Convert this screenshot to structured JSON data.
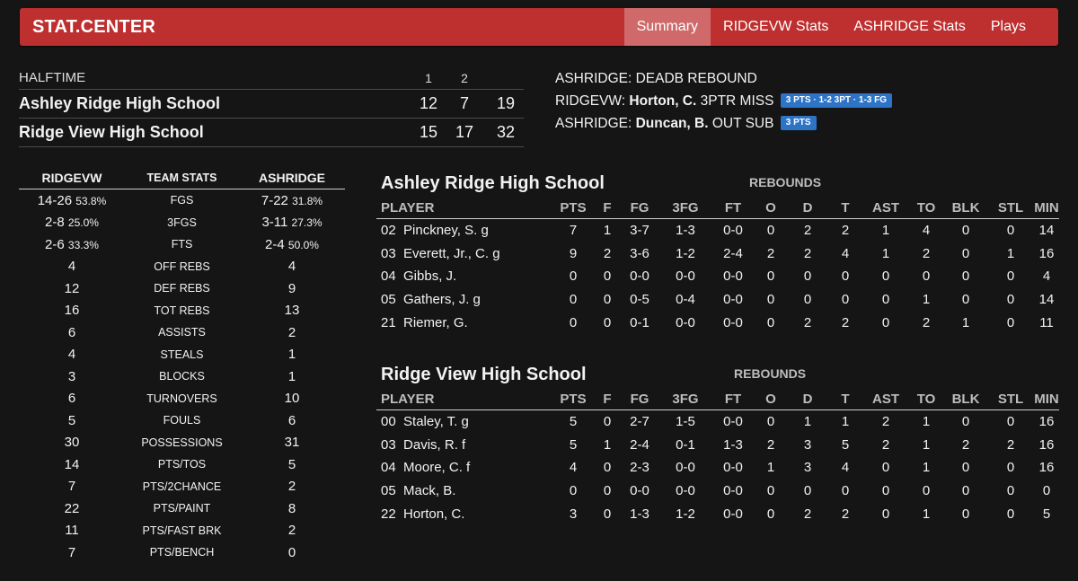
{
  "header": {
    "brand": "STAT.CENTER",
    "nav": [
      "Summary",
      "RIDGEVW Stats",
      "ASHRIDGE Stats",
      "Plays"
    ],
    "active_index": 0
  },
  "scoreboard": {
    "period_label": "HALFTIME",
    "periods": [
      "1",
      "2"
    ],
    "teams": [
      {
        "name": "Ashley Ridge High School",
        "p1": "12",
        "p2": "7",
        "total": "19"
      },
      {
        "name": "Ridge View High School",
        "p1": "15",
        "p2": "17",
        "total": "32"
      }
    ]
  },
  "plays": [
    {
      "team": "ASHRIDGE:",
      "player": "",
      "action": "DEADB REBOUND",
      "badge": ""
    },
    {
      "team": "RIDGEVW:",
      "player": "Horton, C.",
      "action": "3PTR MISS",
      "badge": "3 PTS · 1-2 3PT · 1-3 FG"
    },
    {
      "team": "ASHRIDGE:",
      "player": "Duncan, B.",
      "action": "OUT SUB",
      "badge": "3 PTS"
    }
  ],
  "team_stats": {
    "headers": [
      "RIDGEVW",
      "TEAM STATS",
      "ASHRIDGE"
    ],
    "rows": [
      {
        "l": "14-26",
        "lp": "53.8%",
        "label": "FGS",
        "r": "7-22",
        "rp": "31.8%"
      },
      {
        "l": "2-8",
        "lp": "25.0%",
        "label": "3FGS",
        "r": "3-11",
        "rp": "27.3%"
      },
      {
        "l": "2-6",
        "lp": "33.3%",
        "label": "FTS",
        "r": "2-4",
        "rp": "50.0%"
      },
      {
        "l": "4",
        "lp": "",
        "label": "OFF REBS",
        "r": "4",
        "rp": ""
      },
      {
        "l": "12",
        "lp": "",
        "label": "DEF REBS",
        "r": "9",
        "rp": ""
      },
      {
        "l": "16",
        "lp": "",
        "label": "TOT REBS",
        "r": "13",
        "rp": ""
      },
      {
        "l": "6",
        "lp": "",
        "label": "ASSISTS",
        "r": "2",
        "rp": ""
      },
      {
        "l": "4",
        "lp": "",
        "label": "STEALS",
        "r": "1",
        "rp": ""
      },
      {
        "l": "3",
        "lp": "",
        "label": "BLOCKS",
        "r": "1",
        "rp": ""
      },
      {
        "l": "6",
        "lp": "",
        "label": "TURNOVERS",
        "r": "10",
        "rp": ""
      },
      {
        "l": "5",
        "lp": "",
        "label": "FOULS",
        "r": "6",
        "rp": ""
      },
      {
        "l": "30",
        "lp": "",
        "label": "POSSESSIONS",
        "r": "31",
        "rp": ""
      },
      {
        "l": "14",
        "lp": "",
        "label": "PTS/TOS",
        "r": "5",
        "rp": ""
      },
      {
        "l": "7",
        "lp": "",
        "label": "PTS/2CHANCE",
        "r": "2",
        "rp": ""
      },
      {
        "l": "22",
        "lp": "",
        "label": "PTS/PAINT",
        "r": "8",
        "rp": ""
      },
      {
        "l": "11",
        "lp": "",
        "label": "PTS/FAST BRK",
        "r": "2",
        "rp": ""
      },
      {
        "l": "7",
        "lp": "",
        "label": "PTS/BENCH",
        "r": "0",
        "rp": ""
      }
    ]
  },
  "box_scores": [
    {
      "title": "Ashley Ridge High School",
      "rebounds_label": "REBOUNDS",
      "columns": [
        "PLAYER",
        "PTS",
        "F",
        "FG",
        "3FG",
        "FT",
        "O",
        "D",
        "T",
        "AST",
        "TO",
        "BLK",
        "STL",
        "MIN"
      ],
      "rows": [
        [
          "02  Pinckney, S. g",
          "7",
          "1",
          "3-7",
          "1-3",
          "0-0",
          "0",
          "2",
          "2",
          "1",
          "4",
          "0",
          "0",
          "14"
        ],
        [
          "03  Everett, Jr., C. g",
          "9",
          "2",
          "3-6",
          "1-2",
          "2-4",
          "2",
          "2",
          "4",
          "1",
          "2",
          "0",
          "1",
          "16"
        ],
        [
          "04  Gibbs, J.",
          "0",
          "0",
          "0-0",
          "0-0",
          "0-0",
          "0",
          "0",
          "0",
          "0",
          "0",
          "0",
          "0",
          "4"
        ],
        [
          "05  Gathers, J. g",
          "0",
          "0",
          "0-5",
          "0-4",
          "0-0",
          "0",
          "0",
          "0",
          "0",
          "1",
          "0",
          "0",
          "14"
        ],
        [
          "21  Riemer, G.",
          "0",
          "0",
          "0-1",
          "0-0",
          "0-0",
          "0",
          "2",
          "2",
          "0",
          "2",
          "1",
          "0",
          "11"
        ]
      ]
    },
    {
      "title": "Ridge View High School",
      "rebounds_label": "REBOUNDS",
      "columns": [
        "PLAYER",
        "PTS",
        "F",
        "FG",
        "3FG",
        "FT",
        "O",
        "D",
        "T",
        "AST",
        "TO",
        "BLK",
        "STL",
        "MIN"
      ],
      "rows": [
        [
          "00  Staley, T. g",
          "5",
          "0",
          "2-7",
          "1-5",
          "0-0",
          "0",
          "1",
          "1",
          "2",
          "1",
          "0",
          "0",
          "16"
        ],
        [
          "03  Davis, R. f",
          "5",
          "1",
          "2-4",
          "0-1",
          "1-3",
          "2",
          "3",
          "5",
          "2",
          "1",
          "2",
          "2",
          "16"
        ],
        [
          "04  Moore, C. f",
          "4",
          "0",
          "2-3",
          "0-0",
          "0-0",
          "1",
          "3",
          "4",
          "0",
          "1",
          "0",
          "0",
          "16"
        ],
        [
          "05  Mack, B.",
          "0",
          "0",
          "0-0",
          "0-0",
          "0-0",
          "0",
          "0",
          "0",
          "0",
          "0",
          "0",
          "0",
          "0"
        ],
        [
          "22  Horton, C.",
          "3",
          "0",
          "1-3",
          "1-2",
          "0-0",
          "0",
          "2",
          "2",
          "0",
          "1",
          "0",
          "0",
          "5"
        ]
      ]
    }
  ]
}
